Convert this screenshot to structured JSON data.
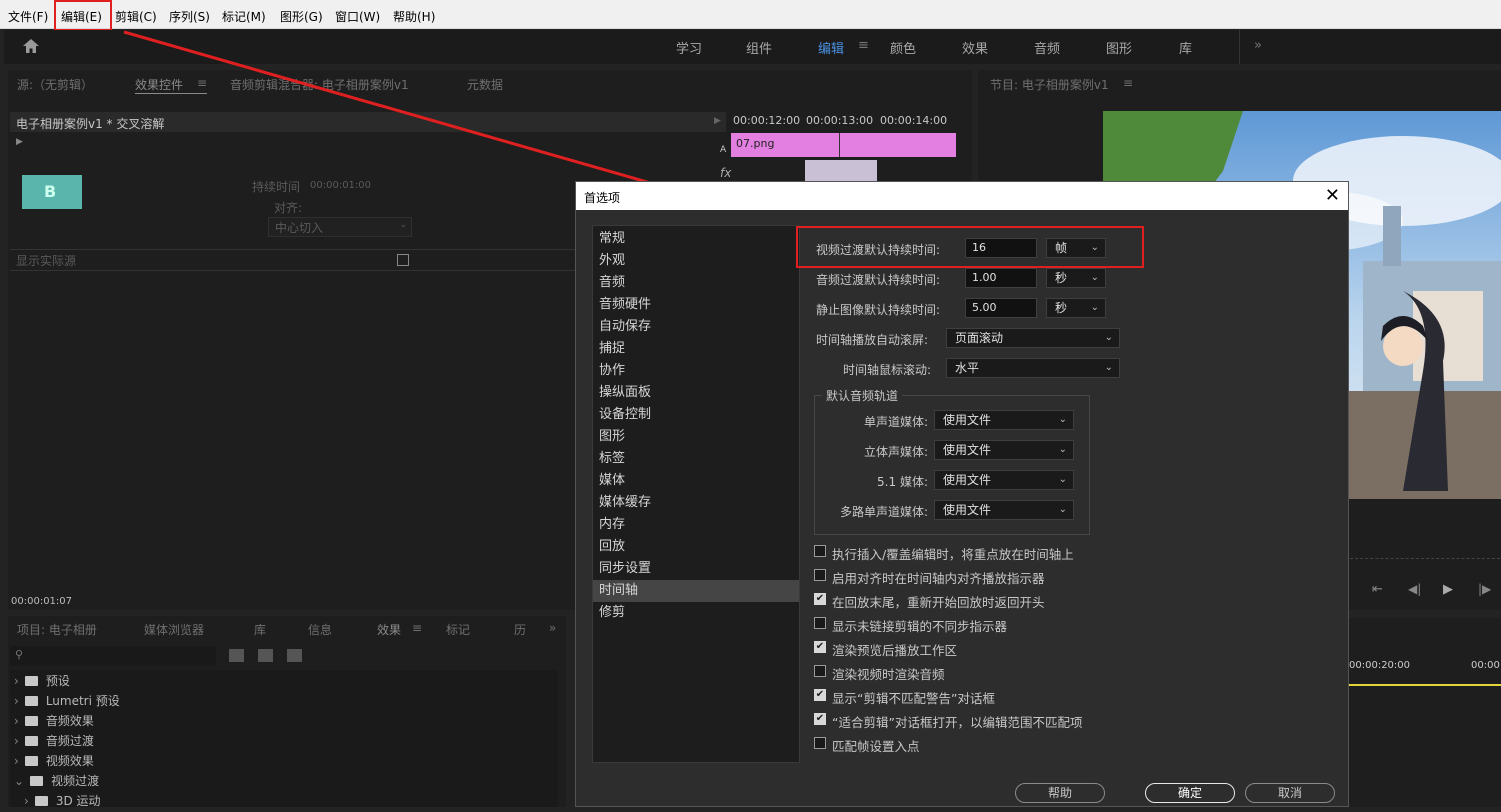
{
  "menubar": [
    "文件(F)",
    "编辑(E)",
    "剪辑(C)",
    "序列(S)",
    "标记(M)",
    "图形(G)",
    "窗口(W)",
    "帮助(H)"
  ],
  "topnav": [
    "学习",
    "组件",
    "编辑",
    "颜色",
    "效果",
    "音频",
    "图形",
    "库"
  ],
  "source_panel": {
    "tabs": [
      "源:（无剪辑）",
      "效果控件",
      "音频剪辑混合器: 电子相册案例v1",
      "元数据"
    ],
    "clip_name": "电子相册案例v1 * 交叉溶解",
    "duration_label": "持续时间",
    "duration_value": "00:00:01:00",
    "align_label": "对齐:",
    "align_value": "中心切入",
    "show_actual_source": "显示实际源",
    "timecodes": [
      "00:00:12:00",
      "00:00:13:00",
      "00:00:14:00"
    ],
    "clip_file": "07.png",
    "track_a": "A",
    "fx": "fx",
    "current_time": "00:00:01:07",
    "thumb_letter": "B"
  },
  "program_panel": {
    "title": "节目: 电子相册案例v1",
    "timeline_time": "00:00:20:00",
    "timeline_time2": "00:00"
  },
  "project_panel": {
    "tabs": [
      "项目: 电子相册",
      "媒体浏览器",
      "库",
      "信息",
      "效果",
      "标记",
      "历"
    ],
    "tree": [
      "预设",
      "Lumetri 预设",
      "音频效果",
      "音频过渡",
      "视频效果",
      "视频过渡",
      "3D 运动"
    ]
  },
  "dialog": {
    "title": "首选项",
    "categories": [
      "常规",
      "外观",
      "音频",
      "音频硬件",
      "自动保存",
      "捕捉",
      "协作",
      "操纵面板",
      "设备控制",
      "图形",
      "标签",
      "媒体",
      "媒体缓存",
      "内存",
      "回放",
      "同步设置",
      "时间轴",
      "修剪"
    ],
    "selected_category": "时间轴",
    "video_transition": {
      "label": "视频过渡默认持续时间:",
      "value": "16",
      "unit": "帧"
    },
    "audio_transition": {
      "label": "音频过渡默认持续时间:",
      "value": "1.00",
      "unit": "秒"
    },
    "still_image": {
      "label": "静止图像默认持续时间:",
      "value": "5.00",
      "unit": "秒"
    },
    "auto_scroll": {
      "label": "时间轴播放自动滚屏:",
      "value": "页面滚动"
    },
    "mouse_scroll": {
      "label": "时间轴鼠标滚动:",
      "value": "水平"
    },
    "audio_tracks": {
      "legend": "默认音频轨道",
      "rows": [
        {
          "label": "单声道媒体:",
          "value": "使用文件"
        },
        {
          "label": "立体声媒体:",
          "value": "使用文件"
        },
        {
          "label": "5.1 媒体:",
          "value": "使用文件"
        },
        {
          "label": "多路单声道媒体:",
          "value": "使用文件"
        }
      ]
    },
    "checkboxes": [
      {
        "label": "执行插入/覆盖编辑时，将重点放在时间轴上",
        "checked": false
      },
      {
        "label": "启用对齐时在时间轴内对齐播放指示器",
        "checked": false
      },
      {
        "label": "在回放末尾，重新开始回放时返回开头",
        "checked": true
      },
      {
        "label": "显示未链接剪辑的不同步指示器",
        "checked": false
      },
      {
        "label": "渲染预览后播放工作区",
        "checked": true
      },
      {
        "label": "渲染视频时渲染音频",
        "checked": false
      },
      {
        "label": "显示“剪辑不匹配警告”对话框",
        "checked": true
      },
      {
        "label": "“适合剪辑”对话框打开，以编辑范围不匹配项",
        "checked": true
      },
      {
        "label": "匹配帧设置入点",
        "checked": false
      }
    ],
    "buttons": {
      "help": "帮助",
      "ok": "确定",
      "cancel": "取消"
    }
  },
  "colors": {
    "accent": "#4a90e2",
    "annotation": "#e02020",
    "clip": "#e27fe0"
  }
}
